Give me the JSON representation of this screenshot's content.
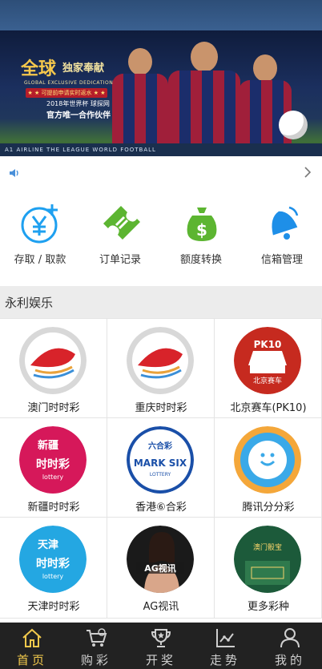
{
  "banner": {
    "logo_main": "全球",
    "logo_sub": "独家奉献",
    "tagline": "GLOBAL EXCLUSIVE DEDICATION",
    "ribbon": "★ ★ 可提前申请实时返水 ★ ★",
    "line1": "2018年世界杯 球探网",
    "line2": "官方唯一合作伙伴",
    "strip_text": "A1 AIRLINE THE LEAGUE WORLD FOOTBALL"
  },
  "quick_links": [
    {
      "label": "存取 / 取款",
      "icon": "wallet-yen-icon",
      "color": "#1ea0f0"
    },
    {
      "label": "订单记录",
      "icon": "ticket-icon",
      "color": "#5cb531"
    },
    {
      "label": "额度转换",
      "icon": "money-bag-icon",
      "color": "#5cb531"
    },
    {
      "label": "信箱管理",
      "icon": "bell-icon",
      "color": "#1e8fe8"
    }
  ],
  "section_title": "永利娱乐",
  "games": [
    {
      "label": "澳门时时彩",
      "icon": "ssc-logo-icon"
    },
    {
      "label": "重庆时时彩",
      "icon": "ssc-logo-icon"
    },
    {
      "label": "北京赛车(PK10)",
      "icon": "pk10-logo-icon",
      "badge": "PK10",
      "badge_sub": "北京赛车"
    },
    {
      "label": "新疆时时彩",
      "icon": "xinjiang-ssc-logo-icon",
      "badge": "新疆",
      "badge_sub": "时时彩"
    },
    {
      "label": "香港⑥合彩",
      "icon": "mark-six-logo-icon",
      "badge": "六合彩",
      "badge_sub": "MARK SIX"
    },
    {
      "label": "腾讯分分彩",
      "icon": "qq-logo-icon"
    },
    {
      "label": "天津时时彩",
      "icon": "tianjin-ssc-logo-icon",
      "badge": "天津",
      "badge_sub": "时时彩"
    },
    {
      "label": "AG视讯",
      "icon": "ag-live-logo-icon",
      "badge": "AG视讯"
    },
    {
      "label": "更多彩种",
      "icon": "more-games-logo-icon",
      "badge": "澳门骰宝"
    }
  ],
  "nav": [
    {
      "label": "首页",
      "icon": "home-icon",
      "active": true
    },
    {
      "label": "购彩",
      "icon": "cart-icon",
      "active": false
    },
    {
      "label": "开奖",
      "icon": "trophy-icon",
      "active": false
    },
    {
      "label": "走势",
      "icon": "trend-icon",
      "active": false
    },
    {
      "label": "我的",
      "icon": "user-icon",
      "active": false
    }
  ],
  "colors": {
    "nav_active": "#f2c94c",
    "nav_inactive": "#cfcfcf",
    "nav_bg": "#222222"
  }
}
